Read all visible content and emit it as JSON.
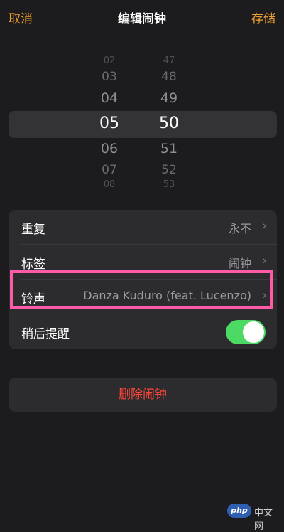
{
  "nav": {
    "cancel": "取消",
    "title": "编辑闹钟",
    "save": "存储"
  },
  "picker": {
    "hours": [
      "02",
      "03",
      "04",
      "05",
      "06",
      "07",
      "08"
    ],
    "minutes": [
      "47",
      "48",
      "49",
      "50",
      "51",
      "52",
      "53"
    ],
    "selected_hour": "05",
    "selected_minute": "50"
  },
  "settings": {
    "repeat": {
      "label": "重复",
      "value": "永不"
    },
    "tag": {
      "label": "标签",
      "value": "闹钟"
    },
    "ringtone": {
      "label": "铃声",
      "value": "Danza Kuduro (feat. Lucenzo)"
    },
    "snooze": {
      "label": "稍后提醒",
      "enabled": true
    }
  },
  "delete_label": "删除闹钟",
  "watermark": {
    "logo": "php",
    "text": "中文网"
  },
  "colors": {
    "accent": "#f0a030",
    "toggle_on": "#4cd964",
    "delete": "#ff453a",
    "highlight": "#ff5aa8"
  }
}
